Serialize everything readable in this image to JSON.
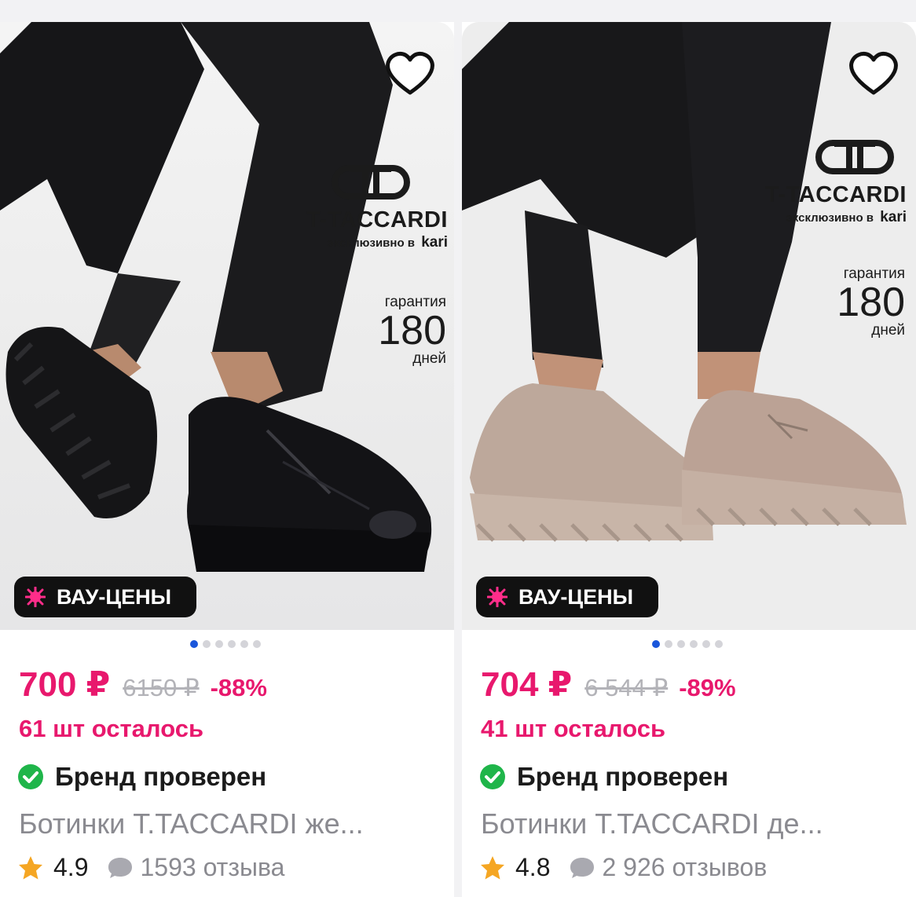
{
  "cards": [
    {
      "brand": {
        "name": "T-TACCARDI",
        "exclusive": "эксклюзивно в",
        "store": "kari"
      },
      "guarantee": {
        "top": "гарантия",
        "number": "180",
        "bottom": "дней"
      },
      "badge": "ВАУ-ЦЕНЫ",
      "price": "700 ₽",
      "old_price": "6150 ₽",
      "discount": "-88%",
      "stock": "61 шт осталось",
      "verified": "Бренд проверен",
      "title": "Ботинки T.TACCARDI же...",
      "rating": "4.9",
      "reviews": "1593 отзыва",
      "shoe_color": "#131316"
    },
    {
      "brand": {
        "name": "T-TACCARDI",
        "exclusive": "эксклюзивно в",
        "store": "kari"
      },
      "guarantee": {
        "top": "гарантия",
        "number": "180",
        "bottom": "дней"
      },
      "badge": "ВАУ-ЦЕНЫ",
      "price": "704 ₽",
      "old_price": "6 544 ₽",
      "discount": "-89%",
      "stock": "41 шт осталось",
      "verified": "Бренд проверен",
      "title": "Ботинки T.TACCARDI де...",
      "rating": "4.8",
      "reviews": "2 926 отзывов",
      "shoe_color": "#bda89b"
    }
  ],
  "colors": {
    "accent": "#e8186d",
    "verified": "#1fb54a",
    "star": "#f5a623",
    "dot_active": "#1a56db"
  }
}
